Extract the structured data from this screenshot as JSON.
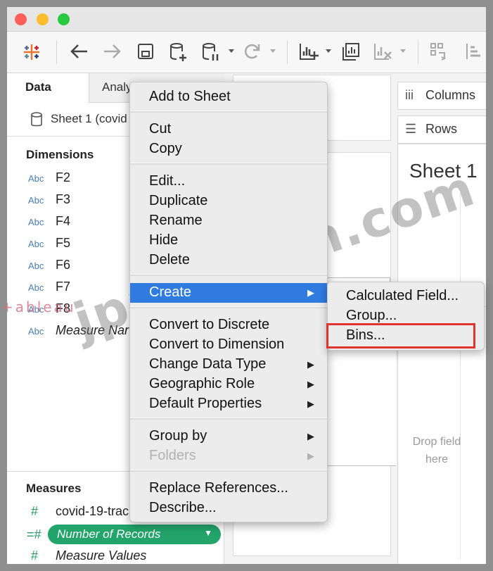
{
  "data_pane": {
    "tab_data": "Data",
    "tab_analytics": "Analy",
    "source": "Sheet 1 (covid",
    "dimensions_title": "Dimensions",
    "dimension_type": "Abc",
    "dimensions": [
      "F2",
      "F3",
      "F4",
      "F5",
      "F6",
      "F7",
      "F8",
      "Measure Nar"
    ],
    "measures_title": "Measures",
    "measures": [
      "covid-19-trac",
      "Number of Records",
      "Measure Values"
    ]
  },
  "shelves": {
    "columns": "Columns",
    "rows": "Rows"
  },
  "canvas": {
    "sheet_title": "Sheet 1",
    "drop_hint": "Drop field here"
  },
  "context_menu": {
    "items": [
      "Add to Sheet",
      "Cut",
      "Copy",
      "Edit...",
      "Duplicate",
      "Rename",
      "Hide",
      "Delete",
      "Create",
      "Convert to Discrete",
      "Convert to Dimension",
      "Change Data Type",
      "Geographic Role",
      "Default Properties",
      "Group by",
      "Folders",
      "Replace References...",
      "Describe..."
    ]
  },
  "create_submenu": {
    "items": [
      "Calculated Field...",
      "Group...",
      "Bins..."
    ]
  },
  "watermark": {
    "text": "jpnshiken.com",
    "logo": "+ableau"
  },
  "colors": {
    "menu_highlight": "#2f7be0",
    "pill_green": "#23a46a",
    "callout_red": "#e0342e"
  }
}
